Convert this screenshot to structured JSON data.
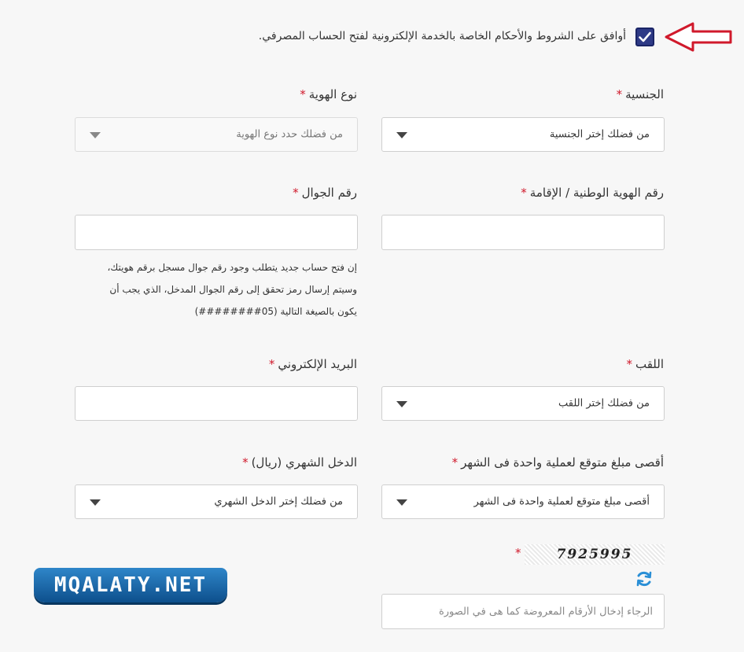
{
  "terms": {
    "text": "أوافق على الشروط والأحكام الخاصة بالخدمة الإلكترونية لفتح الحساب المصرفي.",
    "checked": true,
    "arrow_color": "#d0192b"
  },
  "colors": {
    "required": "#d0192b",
    "checkbox": "#2e3a86",
    "refresh": "#2a8fd6"
  },
  "fields": {
    "nationality": {
      "label": "الجنسية",
      "required": "*",
      "value": "من فضلك إختر الجنسية"
    },
    "id_type": {
      "label": "نوع الهوية",
      "required": "*",
      "value": "من فضلك حدد نوع الهوية"
    },
    "national_id": {
      "label": "رقم الهوية الوطنية / الإقامة",
      "required": "*",
      "value": ""
    },
    "mobile": {
      "label": "رقم الجوال",
      "required": "*",
      "value": "",
      "hint": [
        "إن فتح حساب جديد يتطلب وجود رقم جوال مسجل برقم هويتك،",
        "وسيتم إرسال رمز تحقق إلى رقم الجوال المدخل، الذي يجب أن",
        "يكون بالصيغة التالية (05########)"
      ]
    },
    "title": {
      "label": "اللقب",
      "required": "*",
      "value": "من فضلك إختر اللقب"
    },
    "email": {
      "label": "البريد الإلكتروني",
      "required": "*",
      "value": ""
    },
    "max_amount": {
      "label": "أقصى مبلغ متوقع لعملية واحدة فى الشهر",
      "required": "*",
      "value": "أقصى مبلغ متوقع لعملية واحدة فى الشهر"
    },
    "income": {
      "label": "الدخل الشهري (ريال)",
      "required": "*",
      "value": "من فضلك إختر الدخل الشهري"
    }
  },
  "captcha": {
    "required": "*",
    "image_text": "7925995",
    "refresh_icon": "refresh-icon",
    "placeholder": "الرجاء إدخال الأرقام المعروضة كما هى في الصورة"
  },
  "watermark": {
    "text": "MQALATY.NET"
  }
}
